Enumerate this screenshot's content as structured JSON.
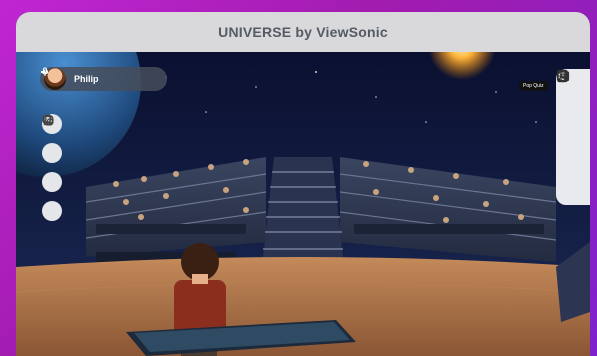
{
  "window": {
    "title": "UNIVERSE by ViewSonic"
  },
  "user": {
    "name": "Philip",
    "avatar_icon": "user-avatar",
    "mic_icon": "microphone-icon",
    "speaker_icon": "speaker-icon"
  },
  "left_toolbar": [
    {
      "icon": "chat-bubbles-icon"
    },
    {
      "icon": "emoji-icon"
    },
    {
      "icon": "avatar-settings-icon"
    },
    {
      "icon": "screen-share-icon"
    }
  ],
  "right_toolbar": [
    {
      "icon": "pop-quiz-icon",
      "tooltip": "Pop Quiz"
    },
    {
      "icon": "participants-icon"
    },
    {
      "icon": "globe-icon"
    },
    {
      "icon": "settings-gear-icon"
    },
    {
      "icon": "gallery-icon"
    }
  ],
  "colors": {
    "frame": "#c026d3",
    "titlebar": "#d9d9dc",
    "toolbar": "#e9eaee",
    "space": "#0b1230",
    "floor": "#a9714a"
  }
}
